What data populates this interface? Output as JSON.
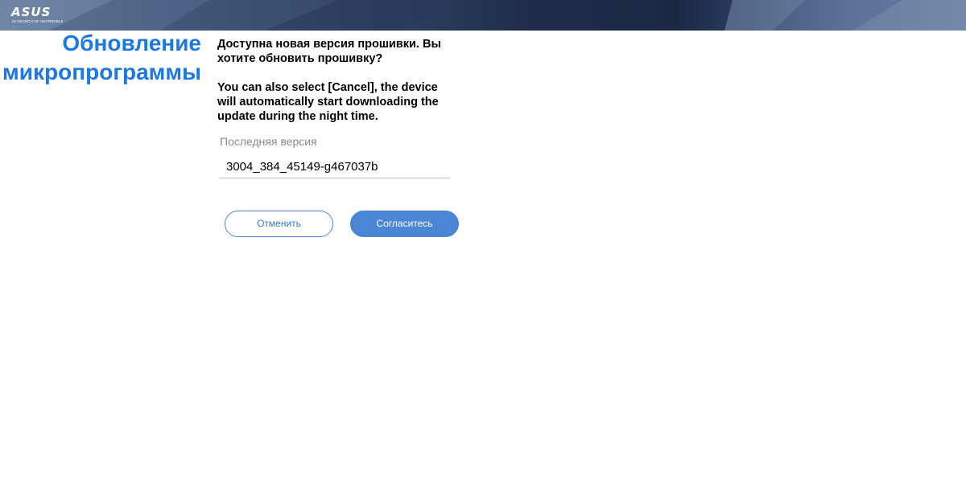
{
  "header": {
    "logo_text": "ASUS",
    "logo_tagline": "IN SEARCH OF INCREDIBLE"
  },
  "page": {
    "title": "Обновление микропрограммы",
    "message_ru": "Доступна новая версия прошивки. Вы хотите обновить прошивку?",
    "message_en": "You can also select [Cancel], the device will automatically start downloading the update during the night time."
  },
  "latest_version": {
    "label": "Последняя версия",
    "value": "3004_384_45149-g467037b"
  },
  "buttons": {
    "cancel_label": "Отменить",
    "accept_label": "Согласитесь"
  },
  "colors": {
    "title": "#1b78e8",
    "accent": "#4a86d4",
    "banner": "#1e2d4b"
  }
}
